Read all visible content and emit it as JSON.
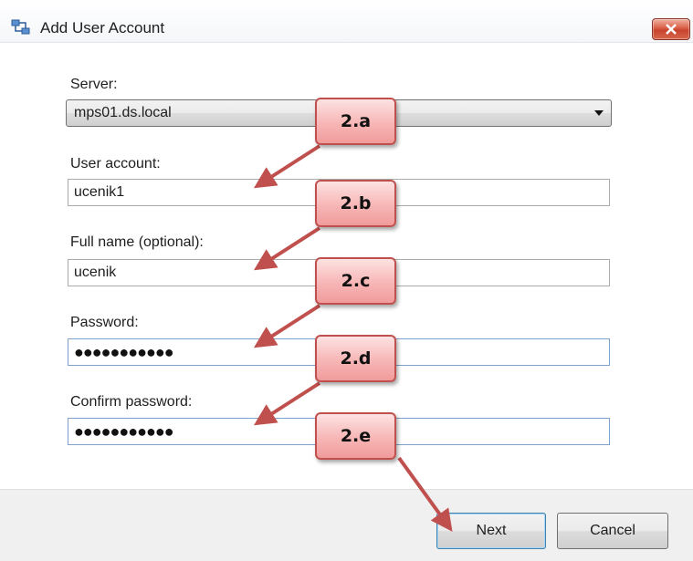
{
  "window": {
    "title": "Add User Account",
    "icon": "network-users-icon",
    "close_icon": "close-icon"
  },
  "form": {
    "server": {
      "label": "Server:",
      "value": "mps01.ds.local"
    },
    "user_account": {
      "label": "User account:",
      "value": "ucenik1"
    },
    "full_name": {
      "label": "Full name (optional):",
      "value": "ucenik"
    },
    "password": {
      "label": "Password:",
      "masked": "●●●●●●●●●●●"
    },
    "confirm_password": {
      "label": "Confirm password:",
      "masked": "●●●●●●●●●●●"
    }
  },
  "buttons": {
    "next": "Next",
    "cancel": "Cancel"
  },
  "annotations": [
    {
      "label": "2.a"
    },
    {
      "label": "2.b"
    },
    {
      "label": "2.c"
    },
    {
      "label": "2.d"
    },
    {
      "label": "2.e"
    }
  ],
  "colors": {
    "callout_border": "#c0504d",
    "callout_fill": "#f7b6b6",
    "arrow": "#c0504d",
    "close_button": "#c8432d"
  }
}
